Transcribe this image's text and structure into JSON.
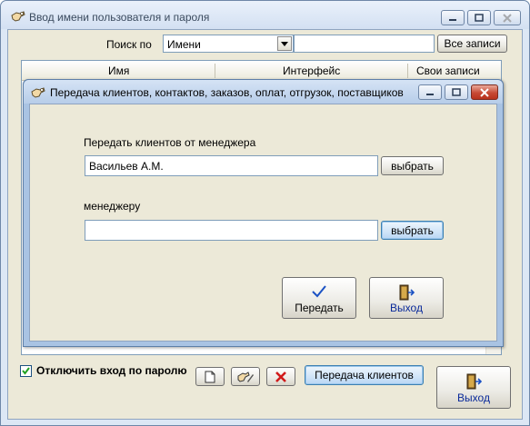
{
  "outer_window": {
    "title": "Ввод имени пользователя и пароля",
    "search_label": "Поиск по",
    "search_field": {
      "value": "Имени",
      "placeholder": ""
    },
    "search_text": {
      "value": ""
    },
    "all_records_label": "Все записи",
    "grid_columns": [
      "Имя",
      "Интерфейс",
      "Свои записи"
    ],
    "disable_password_label": "Отключить вход по паролю",
    "disable_password_checked": true,
    "transfer_clients_label": "Передача клиентов",
    "exit_label": "Выход"
  },
  "dialog": {
    "title": "Передача клиентов, контактов, заказов, оплат, отгрузок, поставщиков",
    "from_label": "Передать клиентов от менеджера",
    "from_value": "Васильев А.М.",
    "choose_label_1": "выбрать",
    "to_label": "менеджеру",
    "to_value": "",
    "choose_label_2": "выбрать",
    "transfer_label": "Передать",
    "exit_label": "Выход"
  },
  "icons": {
    "app": "hand-key-icon",
    "check": "checkmark-icon",
    "exit": "door-exit-icon",
    "new": "new-document-icon",
    "edit": "edit-icon",
    "delete": "delete-x-icon"
  },
  "colors": {
    "window_frame": "#dce7f5",
    "dialog_frame": "#a9c3e3",
    "client_bg": "#ece9d8",
    "close_red": "#c74a35",
    "exit_text": "#0a2a9a"
  }
}
